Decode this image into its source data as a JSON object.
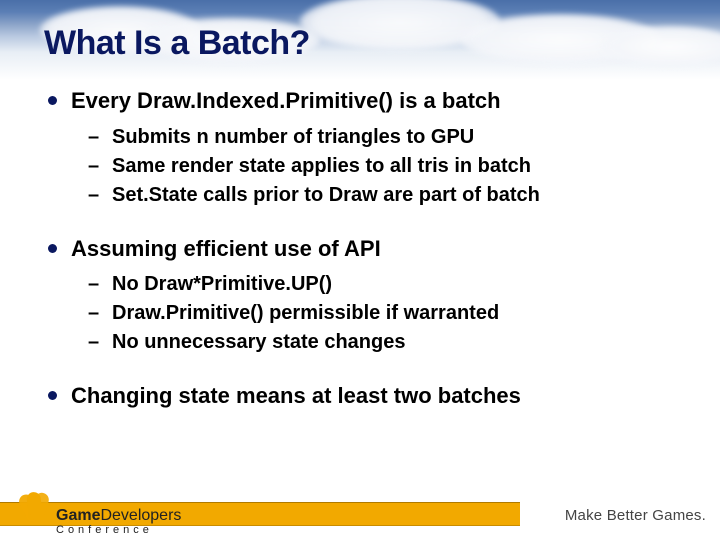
{
  "title": "What Is a Batch?",
  "bullets": [
    {
      "text": "Every Draw.Indexed.Primitive() is a batch",
      "subs": [
        "Submits n number of triangles to GPU",
        "Same render state applies to all tris in batch",
        "Set.State calls prior to Draw are part of batch"
      ]
    },
    {
      "text": "Assuming efficient use of API",
      "subs": [
        "No Draw*Primitive.UP()",
        "Draw.Primitive() permissible if warranted",
        "No unnecessary state changes"
      ]
    },
    {
      "text": "Changing state means at least two batches",
      "subs": []
    }
  ],
  "footer": {
    "logo_word1": "Game",
    "logo_word2": "Developers",
    "logo_sub": "Conference",
    "tagline": "Make Better Games."
  }
}
